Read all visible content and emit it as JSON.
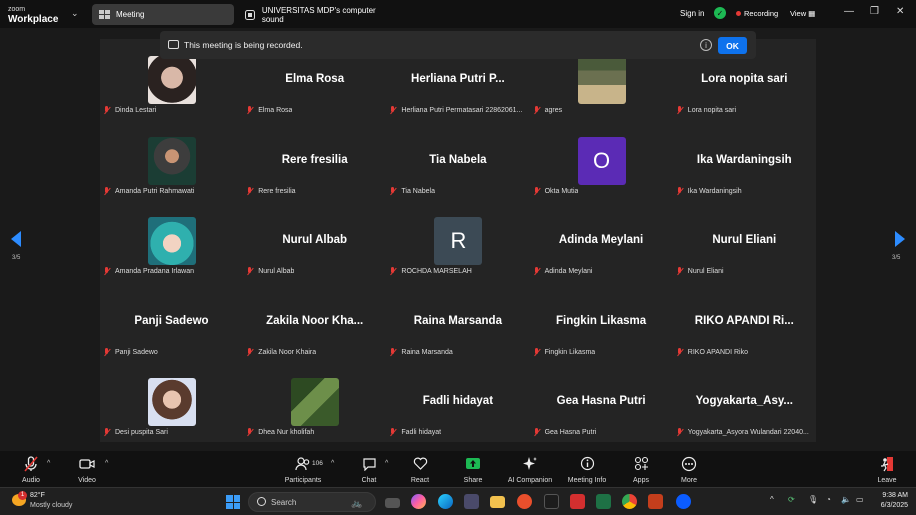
{
  "app": {
    "brand_line1": "zoom",
    "brand_line2": "Workplace"
  },
  "tabs": [
    {
      "label": "Meeting",
      "active": true
    },
    {
      "label": "UNIVERSITAS MDP's computer sound",
      "active": false
    }
  ],
  "titlebar": {
    "signin": "Sign in",
    "recording": "Recording",
    "view": "View"
  },
  "notice": {
    "text": "This meeting is being recorded.",
    "ok": "OK"
  },
  "pager": {
    "left": "3/5",
    "right": "3/5"
  },
  "participants": [
    {
      "display": "",
      "caption": "Dinda Lestari",
      "type": "photo",
      "photo": "photo-dark-hair"
    },
    {
      "display": "Elma Rosa",
      "caption": "Elma Rosa",
      "type": "name"
    },
    {
      "display": "Herliana Putri P...",
      "caption": "Herliana Putri Permatasari 22862061...",
      "type": "name"
    },
    {
      "display": "",
      "caption": "agres",
      "type": "photo",
      "photo": "photo-room"
    },
    {
      "display": "Lora nopita sari",
      "caption": "Lora nopita sari",
      "type": "name"
    },
    {
      "display": "",
      "caption": "Amanda Putri Rahmawati",
      "type": "photo",
      "photo": "photo-hijab"
    },
    {
      "display": "Rere fresilia",
      "caption": "Rere fresilia",
      "type": "name"
    },
    {
      "display": "Tia Nabela",
      "caption": "Tia Nabela",
      "type": "name"
    },
    {
      "display": "",
      "caption": "Okta Mutia",
      "type": "initial",
      "initial": "O",
      "color": "#5b2bb5"
    },
    {
      "display": "Ika Wardaningsih",
      "caption": "Ika Wardaningsih",
      "type": "name"
    },
    {
      "display": "",
      "caption": "Amanda Pradana Irlawan",
      "type": "photo",
      "photo": "photo-teal"
    },
    {
      "display": "Nurul Albab",
      "caption": "Nurul Albab",
      "type": "name"
    },
    {
      "display": "",
      "caption": "ROCHDA MARSELAH",
      "type": "initial",
      "initial": "R",
      "color": "#3c4a55"
    },
    {
      "display": "Adinda Meylani",
      "caption": "Adinda Meylani",
      "type": "name"
    },
    {
      "display": "Nurul Eliani",
      "caption": "Nurul Eliani",
      "type": "name"
    },
    {
      "display": "Panji Sadewo",
      "caption": "Panji Sadewo",
      "type": "name"
    },
    {
      "display": "Zakila Noor Kha...",
      "caption": "Zakila Noor Khaira",
      "type": "name"
    },
    {
      "display": "Raina Marsanda",
      "caption": "Raina Marsanda",
      "type": "name"
    },
    {
      "display": "Fingkin Likasma",
      "caption": "Fingkin Likasma",
      "type": "name"
    },
    {
      "display": "RIKO APANDI Ri...",
      "caption": "RIKO APANDI Riko",
      "type": "name"
    },
    {
      "display": "",
      "caption": "Desi puspita Sari",
      "type": "photo",
      "photo": "photo-woman"
    },
    {
      "display": "",
      "caption": "Dhea Nur kholifah",
      "type": "photo",
      "photo": "photo-nature"
    },
    {
      "display": "Fadli hidayat",
      "caption": "Fadli hidayat",
      "type": "name"
    },
    {
      "display": "Gea Hasna Putri",
      "caption": "Gea Hasna Putri",
      "type": "name"
    },
    {
      "display": "Yogyakarta_Asy...",
      "caption": "Yogyakarta_Asyora Wulandari 22040...",
      "type": "name"
    }
  ],
  "toolbar": {
    "audio": "Audio",
    "video": "Video",
    "participants": "Participants",
    "participant_count": "106",
    "chat": "Chat",
    "react": "React",
    "share": "Share",
    "ai_companion": "AI Companion",
    "meeting_info": "Meeting Info",
    "apps": "Apps",
    "more": "More",
    "leave": "Leave"
  },
  "taskbar": {
    "temp": "82°F",
    "weather": "Mostly cloudy",
    "weather_badge": "1",
    "search_placeholder": "Search",
    "time": "9:38 AM",
    "date": "6/3/2025"
  },
  "colors": {
    "accent": "#0e72ed",
    "share_green": "#1db954",
    "muted_red": "#e53935"
  }
}
